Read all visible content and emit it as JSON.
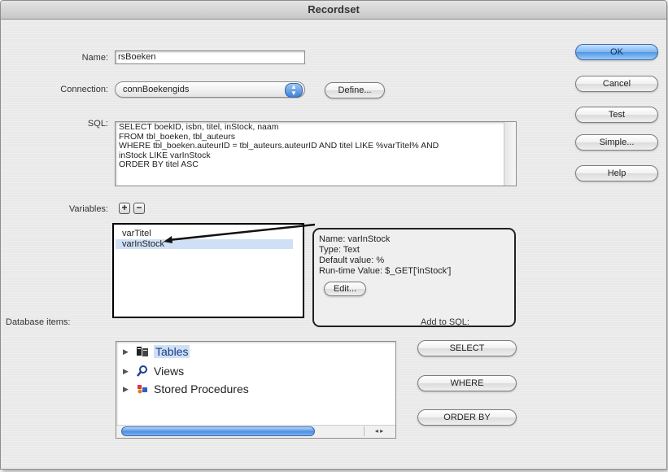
{
  "window": {
    "title": "Recordset"
  },
  "form": {
    "name_label": "Name:",
    "name_value": "rsBoeken",
    "connection_label": "Connection:",
    "connection_value": "connBoekengids",
    "define_label": "Define...",
    "sql_label": "SQL:",
    "sql_lines": [
      "SELECT boekID, isbn, titel, inStock, naam",
      "FROM tbl_boeken, tbl_auteurs",
      "WHERE tbl_boeken.auteurID = tbl_auteurs.auteurID AND titel LIKE %varTitel% AND",
      "inStock LIKE varInStock",
      "ORDER BY titel ASC"
    ],
    "variables_label": "Variables:",
    "add_symbol": "+",
    "remove_symbol": "−"
  },
  "variables": [
    {
      "name": "varTitel",
      "selected": false
    },
    {
      "name": "varInStock",
      "selected": true
    }
  ],
  "variable_detail": {
    "name_line": "Name: varInStock",
    "type_line": "Type: Text",
    "default_line": "Default value: %",
    "runtime_line": "Run-time Value: $_GET['inStock']",
    "edit_label": "Edit..."
  },
  "database": {
    "label": "Database items:",
    "items": [
      {
        "label": "Tables",
        "icon": "table-icon",
        "selected": true
      },
      {
        "label": "Views",
        "icon": "view-icon",
        "selected": false
      },
      {
        "label": "Stored Procedures",
        "icon": "stored-procedure-icon",
        "selected": false
      }
    ],
    "scroll_arrows": "◂ ▸"
  },
  "add_to_sql": {
    "label": "Add to SQL:",
    "select_label": "SELECT",
    "where_label": "WHERE",
    "orderby_label": "ORDER BY"
  },
  "buttons": {
    "ok": "OK",
    "cancel": "Cancel",
    "test": "Test",
    "simple": "Simple...",
    "help": "Help"
  },
  "colors": {
    "accent_blue": "#4f97e4",
    "selection": "#cfe0f6",
    "callout_border": "#222222"
  }
}
